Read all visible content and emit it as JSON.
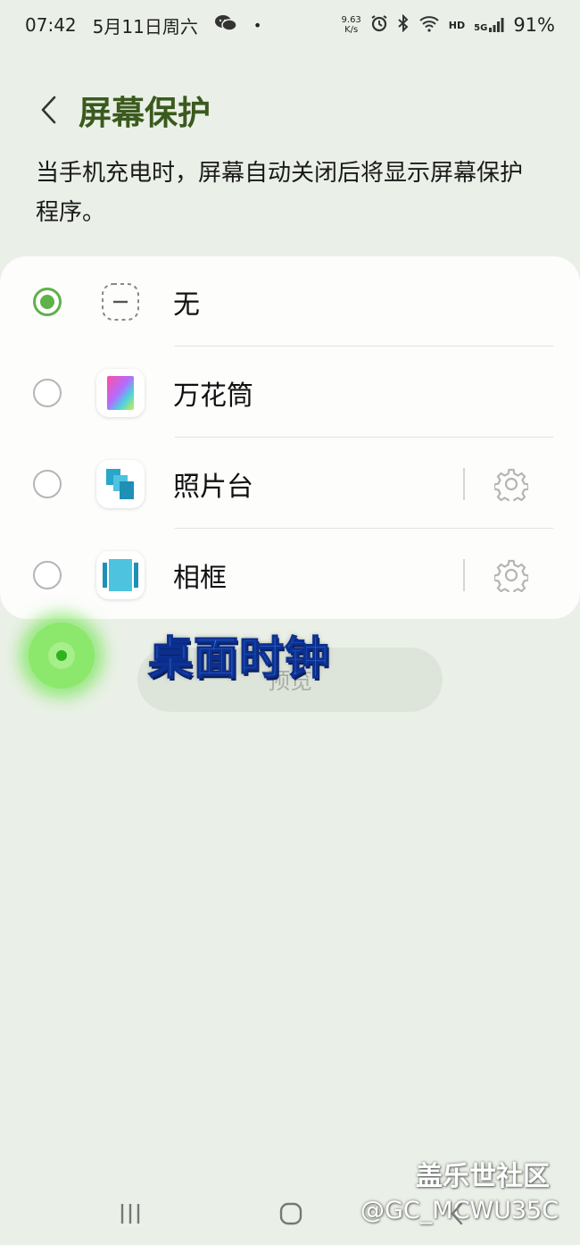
{
  "status_bar": {
    "time": "07:42",
    "date": "5月11日周六",
    "net_speed_value": "9.63",
    "net_speed_unit": "K/s",
    "hd": "HD",
    "network": "5G",
    "battery": "91%",
    "icons": [
      "wechat-icon",
      "alarm-icon",
      "bluetooth-icon",
      "wifi-icon",
      "signal-icon"
    ]
  },
  "header": {
    "title": "屏幕保护"
  },
  "description": "当手机充电时，屏幕自动关闭后将显示屏幕保护程序。",
  "options": [
    {
      "label": "无",
      "icon": "none-icon",
      "selected": true,
      "has_settings": false
    },
    {
      "label": "万花筒",
      "icon": "kaleidoscope-icon",
      "selected": false,
      "has_settings": false
    },
    {
      "label": "照片台",
      "icon": "photo-table-icon",
      "selected": false,
      "has_settings": true
    },
    {
      "label": "相框",
      "icon": "photo-frame-icon",
      "selected": false,
      "has_settings": true
    }
  ],
  "preview_button": {
    "label": "预览"
  },
  "annotation": {
    "text": "桌面时钟"
  },
  "watermark": {
    "title": "盖乐世社区",
    "user": "@GC_MCWU35C"
  },
  "colors": {
    "accent": "#5fb14a",
    "title": "#3a5a1e",
    "background": "#eaf0e7",
    "annotation": "#2b6fe0"
  }
}
